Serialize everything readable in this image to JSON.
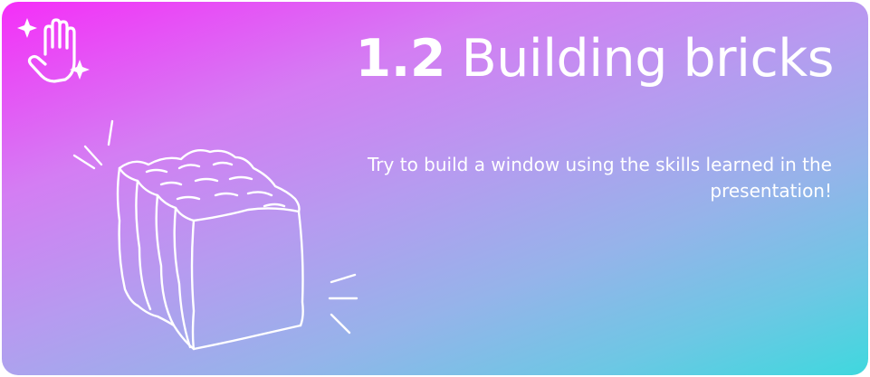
{
  "slide": {
    "title_number": "1.2",
    "title_text": "Building bricks",
    "description": "Try to build a window using the skills learned in the presentation!",
    "icons": {
      "activity": "hand-with-sparkles-icon",
      "illustration": "brick-icon"
    },
    "colors": {
      "gradient_start": "#f52ef8",
      "gradient_middle": "#b79af0",
      "gradient_end": "#3fd8de",
      "text": "#ffffff"
    }
  }
}
